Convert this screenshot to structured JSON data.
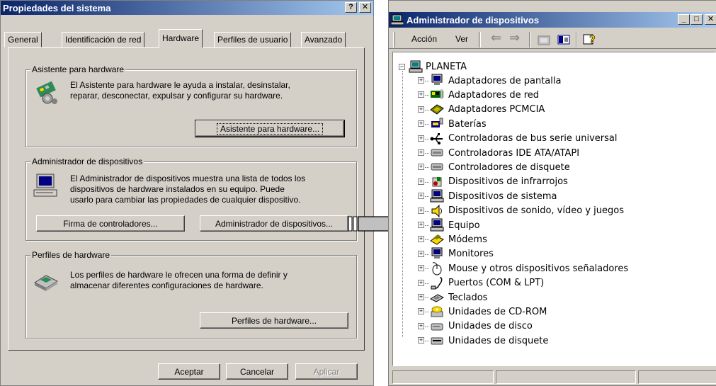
{
  "props": {
    "title": "Propiedades del sistema",
    "help_btn": "?",
    "close_btn": "✕",
    "tabs": [
      "General",
      "Identificación de red",
      "Hardware",
      "Perfiles de usuario",
      "Avanzado"
    ],
    "wizard": {
      "title": "Asistente para hardware",
      "text1": "El Asistente para hardware le ayuda a instalar, desinstalar,",
      "text2": "reparar, desconectar, expulsar y configurar su hardware.",
      "button": "Asistente para hardware..."
    },
    "devmgr": {
      "title": "Administrador de dispositivos",
      "text1": "El Administrador de dispositivos muestra una lista de todos los",
      "text2": "dispositivos de hardware instalados en su equipo. Puede",
      "text3": "usarlo para cambiar las propiedades de cualquier dispositivo.",
      "btn_signing": "Firma de controladores...",
      "btn_devmgr": "Administrador de dispositivos..."
    },
    "profiles": {
      "title": "Perfiles de hardware",
      "text1": "Los perfiles de hardware le ofrecen una forma de definir y",
      "text2": "almacenar diferentes configuraciones de hardware.",
      "button": "Perfiles de hardware..."
    },
    "ok": "Aceptar",
    "cancel": "Cancelar",
    "apply": "Aplicar"
  },
  "dm": {
    "title": "Administrador de dispositivos",
    "min": "_",
    "max": "□",
    "close": "✕",
    "menu_action": "Acción",
    "menu_view": "Ver",
    "root": "PLANETA",
    "items": [
      {
        "label": "Adaptadores de pantalla",
        "icon": "monitor-icon"
      },
      {
        "label": "Adaptadores de red",
        "icon": "network-card-icon"
      },
      {
        "label": "Adaptadores PCMCIA",
        "icon": "pcmcia-icon"
      },
      {
        "label": "Baterías",
        "icon": "battery-icon"
      },
      {
        "label": "Controladoras de bus serie universal",
        "icon": "usb-icon"
      },
      {
        "label": "Controladoras IDE ATA/ATAPI",
        "icon": "ide-controller-icon"
      },
      {
        "label": "Controladores de disquete",
        "icon": "floppy-controller-icon"
      },
      {
        "label": "Dispositivos de infrarrojos",
        "icon": "infrared-icon"
      },
      {
        "label": "Dispositivos de sistema",
        "icon": "system-device-icon"
      },
      {
        "label": "Dispositivos de sonido, vídeo y juegos",
        "icon": "sound-icon"
      },
      {
        "label": "Equipo",
        "icon": "computer-icon"
      },
      {
        "label": "Módems",
        "icon": "modem-icon"
      },
      {
        "label": "Monitores",
        "icon": "monitor-icon"
      },
      {
        "label": "Mouse y otros dispositivos señaladores",
        "icon": "mouse-icon"
      },
      {
        "label": "Puertos (COM & LPT)",
        "icon": "port-icon"
      },
      {
        "label": "Teclados",
        "icon": "keyboard-icon"
      },
      {
        "label": "Unidades de CD-ROM",
        "icon": "cdrom-icon"
      },
      {
        "label": "Unidades de disco",
        "icon": "disk-icon"
      },
      {
        "label": "Unidades de disquete",
        "icon": "floppy-drive-icon"
      }
    ]
  },
  "colors": {
    "titlebar_start": "#0a246a",
    "titlebar_end": "#a6caf0",
    "face": "#d4d0c8",
    "arrow_fill": "#c0c0c0"
  }
}
